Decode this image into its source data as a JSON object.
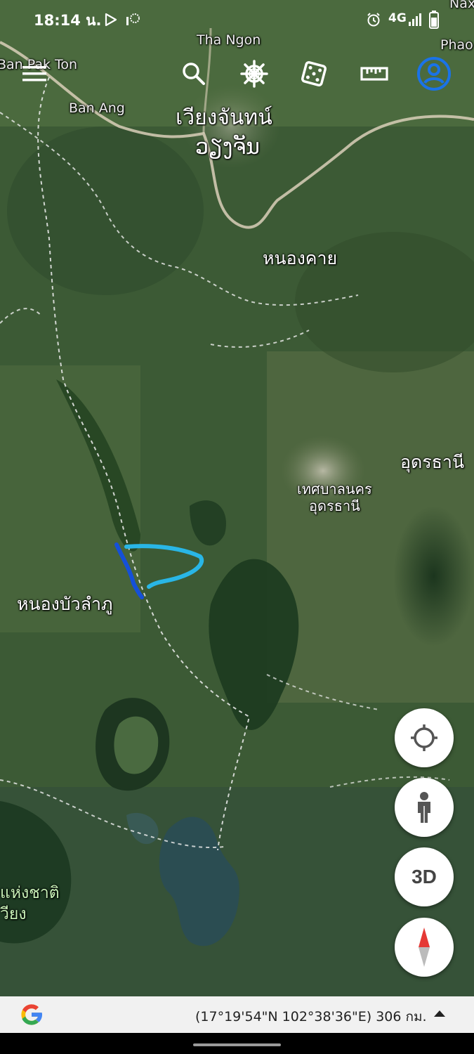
{
  "status_bar": {
    "time": "18:14 น.",
    "network": "4G",
    "icons": [
      "play-store-icon",
      "app-notification-icon",
      "alarm-icon",
      "signal-icon",
      "battery-icon"
    ]
  },
  "toolbar": {
    "icons": [
      "menu-icon",
      "search-icon",
      "voyager-wheel-icon",
      "dice-icon",
      "ruler-icon",
      "account-icon"
    ],
    "accent_color": "#1a73e8"
  },
  "map": {
    "labels": {
      "tha_ngon": "Tha Ngon",
      "phao": "Phao",
      "naxa": "Nax",
      "ban_pak_ton": "Ban Pak Ton",
      "ban_ang": "Ban Ang",
      "vientiane_thai": "เวียงจันทน์",
      "vientiane_lao": "ວຽງຈັນ",
      "nong_khai": "หนองคาย",
      "udon_thani": "อุดรธานี",
      "udon_city_line1": "เทศบาลนคร",
      "udon_city_line2": "อุดรธานี",
      "nong_bua_lamphu": "หนองบัวลำภู",
      "national_park_line1": "แห่งชาติ",
      "national_park_line2": "วียง"
    },
    "measured_path_colors": {
      "dark_segment": "#1550d8",
      "light_segment": "#29b6e6"
    }
  },
  "controls": {
    "my_location_icon": "crosshair-icon",
    "street_view_icon": "pegman-icon",
    "three_d_label": "3D",
    "compass_icon": "compass-icon"
  },
  "bottom_bar": {
    "logo": "google-g-logo",
    "coordinates": "(17°19'54\"N 102°38'36\"E) 306 กม.",
    "expand_icon": "triangle-up-icon"
  }
}
